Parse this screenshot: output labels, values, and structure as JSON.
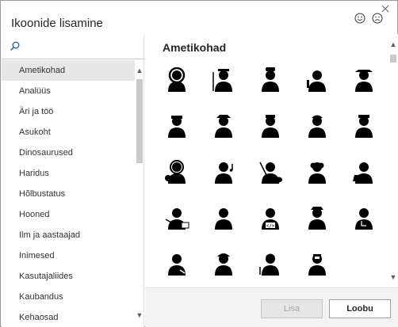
{
  "dialog": {
    "title": "Ikoonide lisamine",
    "close_icon": "close-icon",
    "feedback_icons": [
      "smiley-happy-icon",
      "smiley-sad-icon"
    ]
  },
  "search": {
    "icon": "search-icon",
    "value": ""
  },
  "categories": [
    {
      "label": "Ametikohad",
      "selected": true
    },
    {
      "label": "Analüüs",
      "selected": false
    },
    {
      "label": "Äri ja töö",
      "selected": false
    },
    {
      "label": "Asukoht",
      "selected": false
    },
    {
      "label": "Dinosaurused",
      "selected": false
    },
    {
      "label": "Haridus",
      "selected": false
    },
    {
      "label": "Hõlbustatus",
      "selected": false
    },
    {
      "label": "Hooned",
      "selected": false
    },
    {
      "label": "Ilm ja aastaajad",
      "selected": false
    },
    {
      "label": "Inimesed",
      "selected": false
    },
    {
      "label": "Kasutajaliides",
      "selected": false
    },
    {
      "label": "Kaubandus",
      "selected": false
    },
    {
      "label": "Kehaosad",
      "selected": false
    }
  ],
  "section": {
    "title": "Ametikohad"
  },
  "icons": [
    {
      "name": "astronaut-icon"
    },
    {
      "name": "farmer-icon"
    },
    {
      "name": "chef-icon"
    },
    {
      "name": "bartender-icon"
    },
    {
      "name": "cowboy-icon"
    },
    {
      "name": "soldier-icon"
    },
    {
      "name": "detective-icon"
    },
    {
      "name": "police-officer-icon"
    },
    {
      "name": "firefighter-icon"
    },
    {
      "name": "ship-captain-icon"
    },
    {
      "name": "dj-icon"
    },
    {
      "name": "musician-icon"
    },
    {
      "name": "painter-icon"
    },
    {
      "name": "judge-icon"
    },
    {
      "name": "scientist-icon"
    },
    {
      "name": "teacher-icon"
    },
    {
      "name": "office-worker-icon"
    },
    {
      "name": "programmer-icon"
    },
    {
      "name": "pilot-icon"
    },
    {
      "name": "doctor-icon"
    },
    {
      "name": "mechanic-icon"
    },
    {
      "name": "construction-worker-icon"
    },
    {
      "name": "repair-worker-icon"
    },
    {
      "name": "welder-icon"
    }
  ],
  "footer": {
    "insert_label": "Lisa",
    "cancel_label": "Loobu"
  }
}
